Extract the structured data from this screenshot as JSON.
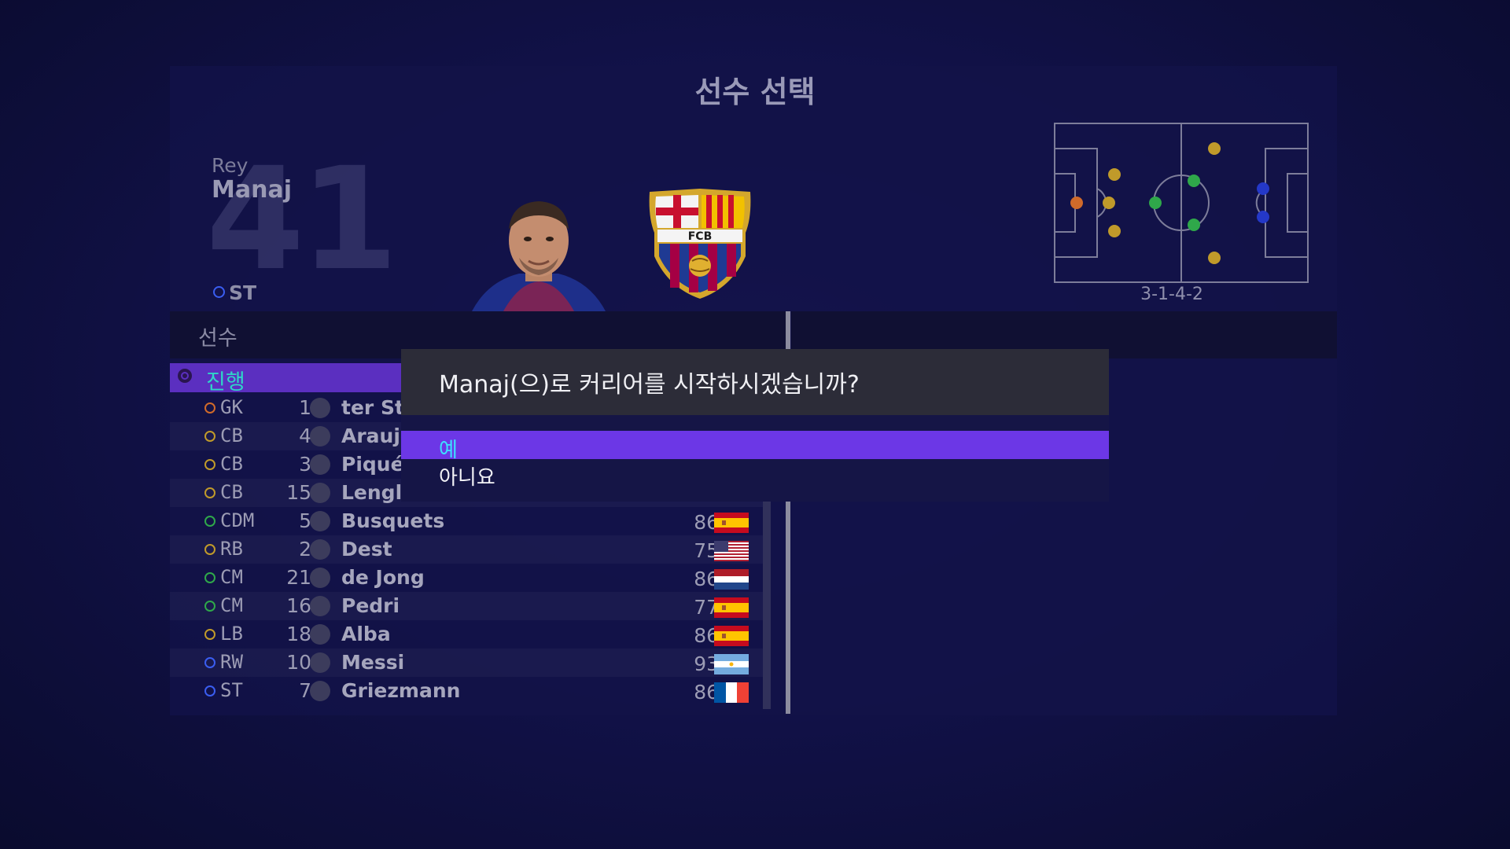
{
  "screen_title": "선수 선택",
  "player": {
    "first_name": "Rey",
    "last_name": "Manaj",
    "number": "41",
    "position": "ST"
  },
  "formation": "3-1-4-2",
  "list_header": "선수",
  "progress_label": "진행",
  "dialog": {
    "question": "Manaj(으)로 커리어를 시작하시겠습니까?",
    "yes_label": "예",
    "no_label": "아니요"
  },
  "roster": [
    {
      "pos": "GK",
      "num": "1",
      "name": "ter Steg",
      "rating": "",
      "pos_color": "#d06a2a",
      "flag": ""
    },
    {
      "pos": "CB",
      "num": "4",
      "name": "Araujo",
      "rating": "",
      "pos_color": "#c09a2a",
      "flag": ""
    },
    {
      "pos": "CB",
      "num": "3",
      "name": "Piqué",
      "rating": "",
      "pos_color": "#c09a2a",
      "flag": ""
    },
    {
      "pos": "CB",
      "num": "15",
      "name": "Lenglet",
      "rating": "",
      "pos_color": "#c09a2a",
      "flag": ""
    },
    {
      "pos": "CDM",
      "num": "5",
      "name": "Busquets",
      "rating": "86",
      "pos_color": "#2fa84a",
      "flag": "spain"
    },
    {
      "pos": "RB",
      "num": "2",
      "name": "Dest",
      "rating": "75",
      "pos_color": "#c09a2a",
      "flag": "usa"
    },
    {
      "pos": "CM",
      "num": "21",
      "name": "de Jong",
      "rating": "86",
      "pos_color": "#2fa84a",
      "flag": "netherlands"
    },
    {
      "pos": "CM",
      "num": "16",
      "name": "Pedri",
      "rating": "77",
      "pos_color": "#2fa84a",
      "flag": "spain"
    },
    {
      "pos": "LB",
      "num": "18",
      "name": "Alba",
      "rating": "86",
      "pos_color": "#c09a2a",
      "flag": "spain"
    },
    {
      "pos": "RW",
      "num": "10",
      "name": "Messi",
      "rating": "93",
      "pos_color": "#3a5df0",
      "flag": "argentina"
    },
    {
      "pos": "ST",
      "num": "7",
      "name": "Griezmann",
      "rating": "86",
      "pos_color": "#3a5df0",
      "flag": "france"
    }
  ],
  "colors": {
    "accent_purple": "#6c37e6",
    "selected_text": "#3de0ff",
    "progress_text": "#2fd6c8",
    "gk": "#d06a2a",
    "def": "#c09a2a",
    "mid": "#2fa84a",
    "att": "#3a5df0"
  },
  "icons": {
    "progress": "target-icon",
    "position_marker": "ring-icon",
    "crest": "fc-barcelona-crest-icon"
  }
}
